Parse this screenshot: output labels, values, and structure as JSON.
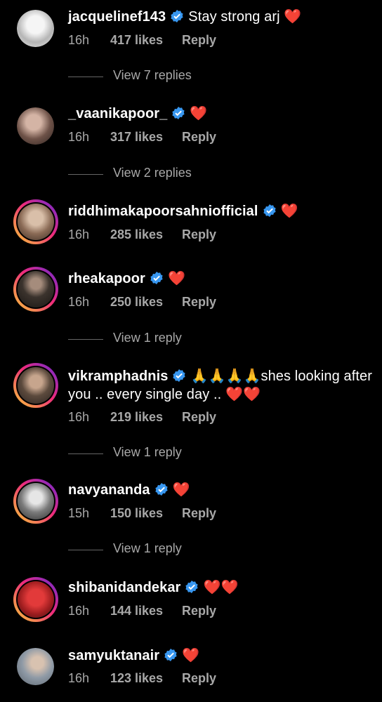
{
  "comments": [
    {
      "username": "jacquelinef143",
      "text": "Stay strong arj",
      "hearts": "❤️",
      "time": "16h",
      "likes": "417 likes",
      "reply": "Reply",
      "view_replies": "View 7 replies",
      "avatar_color": "#cfcfcf"
    },
    {
      "username": "_vaanikapoor_",
      "text": "",
      "hearts": "❤️",
      "time": "16h",
      "likes": "317 likes",
      "reply": "Reply",
      "view_replies": "View 2 replies",
      "avatar_color": "#8a6f66"
    },
    {
      "username": "riddhimakapoorsahniofficial",
      "text": "",
      "hearts": "❤️",
      "time": "16h",
      "likes": "285 likes",
      "reply": "Reply",
      "view_replies": "",
      "avatar_color": "#9a7e6b"
    },
    {
      "username": "rheakapoor",
      "text": "",
      "hearts": "❤️",
      "time": "16h",
      "likes": "250 likes",
      "reply": "Reply",
      "view_replies": "View 1 reply",
      "avatar_color": "#3b332d"
    },
    {
      "username": "vikramphadnis",
      "text_line1": "🙏🙏🙏🙏shes looking after",
      "text_line2": "you .. every single day ..",
      "hearts": "❤️❤️",
      "time": "16h",
      "likes": "219 likes",
      "reply": "Reply",
      "view_replies": "View 1 reply",
      "avatar_color": "#5c4a3d"
    },
    {
      "username": "navyananda",
      "text": "",
      "hearts": "❤️",
      "time": "15h",
      "likes": "150 likes",
      "reply": "Reply",
      "view_replies": "View 1 reply",
      "avatar_color": "#9d9d9d"
    },
    {
      "username": "shibanidandekar",
      "text": "",
      "hearts": "❤️❤️",
      "time": "16h",
      "likes": "144 likes",
      "reply": "Reply",
      "view_replies": "",
      "avatar_color": "#c0282a"
    },
    {
      "username": "samyuktanair",
      "text": "",
      "hearts": "❤️",
      "time": "16h",
      "likes": "123 likes",
      "reply": "Reply",
      "view_replies": "",
      "avatar_color": "#b7bcc3"
    }
  ],
  "colors": {
    "verified": "#3897f0",
    "heart": "#e0102a",
    "meta": "#a8a8a8"
  }
}
